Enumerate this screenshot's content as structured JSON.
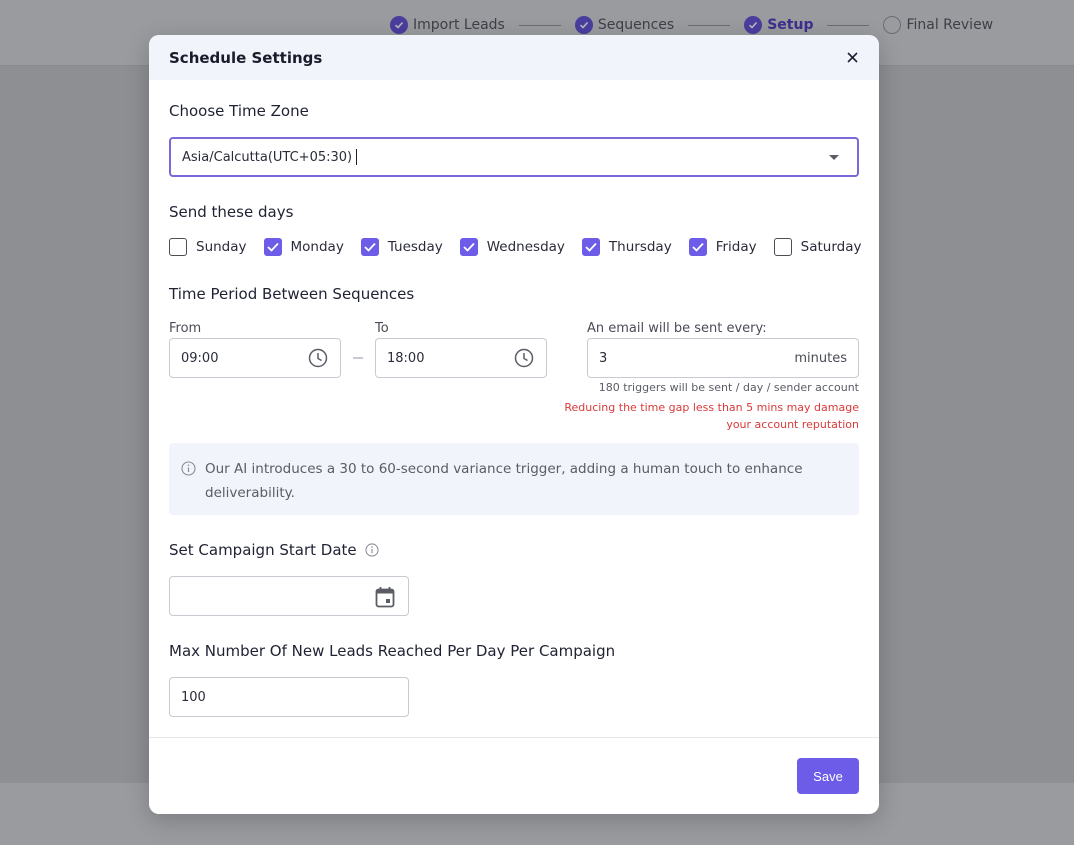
{
  "stepper": {
    "steps": [
      {
        "label": "Import Leads",
        "done": true
      },
      {
        "label": "Sequences",
        "done": true
      },
      {
        "label": "Setup",
        "done": true,
        "active": true
      },
      {
        "label": "Final Review",
        "done": false
      }
    ]
  },
  "modal": {
    "title": "Schedule Settings",
    "timezone": {
      "label": "Choose Time Zone",
      "value": "Asia/Calcutta(UTC+05:30)"
    },
    "days": {
      "label": "Send these days",
      "items": [
        {
          "label": "Sunday",
          "checked": false
        },
        {
          "label": "Monday",
          "checked": true
        },
        {
          "label": "Tuesday",
          "checked": true
        },
        {
          "label": "Wednesday",
          "checked": true
        },
        {
          "label": "Thursday",
          "checked": true
        },
        {
          "label": "Friday",
          "checked": true
        },
        {
          "label": "Saturday",
          "checked": false
        }
      ]
    },
    "time_period": {
      "label": "Time Period Between Sequences",
      "from_label": "From",
      "from_value": "09:00",
      "to_label": "To",
      "to_value": "18:00",
      "interval_label": "An email will be sent every:",
      "interval_value": "3",
      "interval_unit": "minutes",
      "triggers_note": "180 triggers will be sent / day / sender account",
      "warning": "Reducing the time gap less than 5 mins may damage your account reputation"
    },
    "info": "Our AI introduces a 30 to 60-second variance trigger, adding a human touch to enhance deliverability.",
    "start_date": {
      "label": "Set Campaign Start Date",
      "value": ""
    },
    "max_leads": {
      "label": "Max Number Of New Leads Reached Per Day Per Campaign",
      "value": "100"
    },
    "save_label": "Save"
  },
  "colors": {
    "accent": "#6c5ce7",
    "warning": "#d93a3a",
    "info_bg": "#f2f4fb"
  }
}
